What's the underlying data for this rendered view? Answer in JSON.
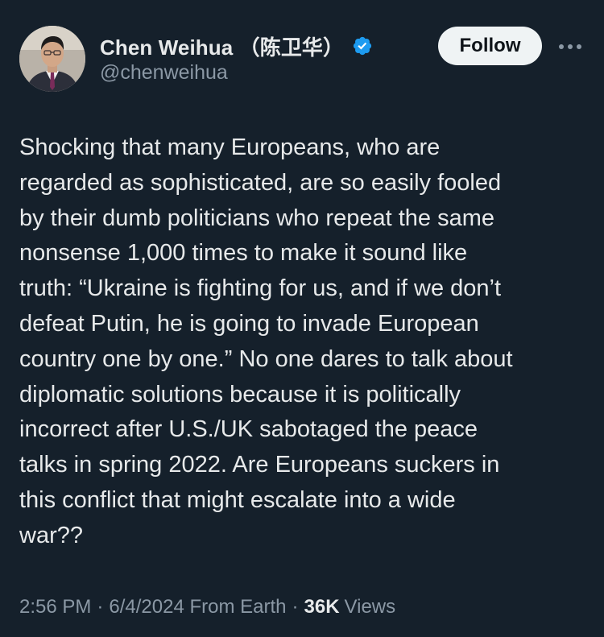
{
  "author": {
    "display_name": "Chen Weihua （陈卫华）",
    "handle": "@chenweihua",
    "verified_icon": "verified-badge-icon",
    "verified_color": "#1d9bf0"
  },
  "actions": {
    "follow_label": "Follow",
    "more_icon": "more-dots-icon"
  },
  "tweet": {
    "text": "Shocking that many Europeans, who are\nregarded as sophisticated, are so easily fooled\nby their dumb politicians who repeat the same\nnonsense 1,000 times to make it sound like\ntruth: “Ukraine is fighting for us, and if we don’t\ndefeat Putin, he is going to invade European\ncountry one by one.” No one dares to talk about\ndiplomatic solutions because it is politically\nincorrect after U.S./UK sabotaged the peace\ntalks in spring 2022.  Are Europeans suckers in\nthis conflict that might escalate into a wide\nwar??",
    "time": "2:56 PM",
    "date": "6/4/2024",
    "source": "From Earth",
    "views_count": "36K",
    "views_label": "Views"
  },
  "colors": {
    "background": "#15202b",
    "text_primary": "#e7e9ea",
    "text_secondary": "#8b98a5",
    "button_bg": "#eff3f4"
  }
}
